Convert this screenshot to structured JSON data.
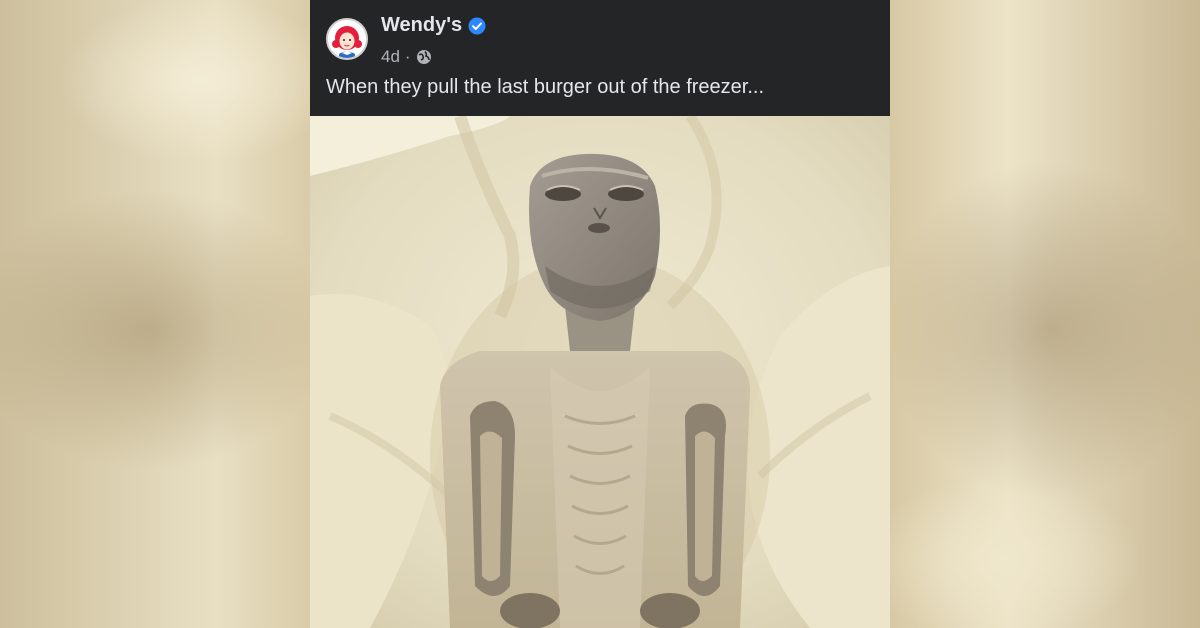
{
  "post": {
    "author": "Wendy's",
    "timestamp": "4d",
    "separator": "·",
    "caption": "When they pull the last burger out of the freezer...",
    "audience_icon": "globe-icon",
    "verified_icon": "verified-badge-icon"
  },
  "image": {
    "subject": "mummified-figure-photo"
  },
  "colors": {
    "post_background": "#242526",
    "name_text": "#e4e6eb",
    "meta_text": "#b0b3b8",
    "verified_blue": "#2d88ff",
    "brand_red": "#e2203d"
  }
}
